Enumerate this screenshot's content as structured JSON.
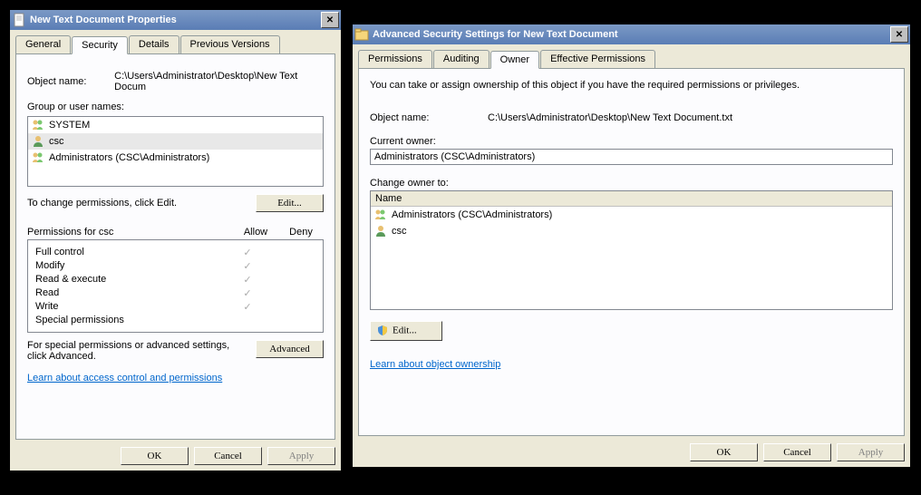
{
  "win1": {
    "title": "New Text Document Properties",
    "tabs": [
      "General",
      "Security",
      "Details",
      "Previous Versions"
    ],
    "objectNameLabel": "Object name:",
    "objectName": "C:\\Users\\Administrator\\Desktop\\New Text Docum",
    "groupLabel": "Group or user names:",
    "users": [
      "SYSTEM",
      "csc",
      "Administrators (CSC\\Administrators)"
    ],
    "changeHint": "To change permissions, click Edit.",
    "editBtn": "Edit...",
    "permFor": "Permissions for csc",
    "allow": "Allow",
    "deny": "Deny",
    "perms": [
      "Full control",
      "Modify",
      "Read & execute",
      "Read",
      "Write",
      "Special permissions"
    ],
    "advHint": "For special permissions or advanced settings, click Advanced.",
    "advBtn": "Advanced",
    "link": "Learn about access control and permissions",
    "ok": "OK",
    "cancel": "Cancel",
    "apply": "Apply"
  },
  "win2": {
    "title": "Advanced Security Settings for New Text Document",
    "tabs": [
      "Permissions",
      "Auditing",
      "Owner",
      "Effective Permissions"
    ],
    "intro": "You can take or assign ownership of this object if you have the required permissions or privileges.",
    "objectNameLabel": "Object name:",
    "objectName": "C:\\Users\\Administrator\\Desktop\\New Text Document.txt",
    "currentOwnerLabel": "Current owner:",
    "currentOwner": "Administrators (CSC\\Administrators)",
    "changeOwnerLabel": "Change owner to:",
    "nameHdr": "Name",
    "owners": [
      "Administrators (CSC\\Administrators)",
      "csc"
    ],
    "editBtn": "Edit...",
    "link": "Learn about object ownership",
    "ok": "OK",
    "cancel": "Cancel",
    "apply": "Apply"
  }
}
